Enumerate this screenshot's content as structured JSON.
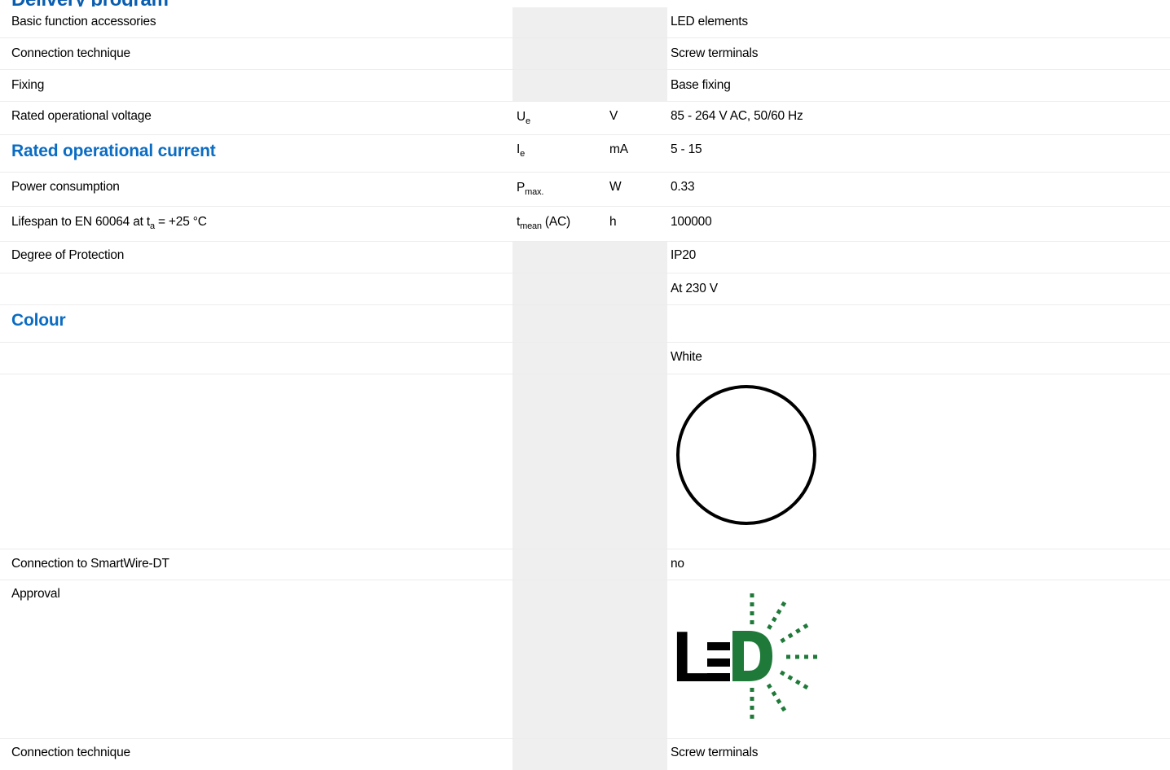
{
  "header": {
    "cut_title": "Delivery program"
  },
  "rows": [
    {
      "label": "Basic function accessories",
      "value": "LED elements"
    },
    {
      "label": "Connection technique",
      "value": "Screw terminals"
    },
    {
      "label": "Fixing",
      "value": "Base fixing"
    },
    {
      "label": "Rated operational voltage",
      "sym": "U",
      "sym_sub": "e",
      "unit": "V",
      "value": "85 - 264 V AC, 50/60 Hz"
    },
    {
      "label": "Rated operational current",
      "sym": "I",
      "sym_sub": "e",
      "unit": "mA",
      "value": "5 - 15"
    },
    {
      "label": "Power consumption",
      "sym": "P",
      "sym_sub": "max.",
      "unit": "W",
      "value": "0.33"
    },
    {
      "label_pre": "Lifespan to EN 60064 at t",
      "label_sub": "a",
      "label_post": " = +25 °C",
      "sym": "t",
      "sym_sub": "mean",
      "sym_post": " (AC)",
      "unit": "h",
      "value": "100000"
    },
    {
      "label": "Degree of Protection",
      "value": "IP20"
    },
    {
      "value": "At 230 V"
    },
    {
      "label": "Colour"
    },
    {
      "value": "White"
    },
    {
      "icon": "white-circle-symbol"
    },
    {
      "label": "Connection to SmartWire-DT",
      "value": "no"
    },
    {
      "label": "Approval",
      "icon": "led-logo",
      "logo_text": "LED"
    },
    {
      "label": "Connection technique",
      "value": "Screw terminals"
    }
  ],
  "colors": {
    "heading_blue": "#0a6cc3",
    "band_grey": "#efefef",
    "led_green": "#1f7a3a"
  }
}
